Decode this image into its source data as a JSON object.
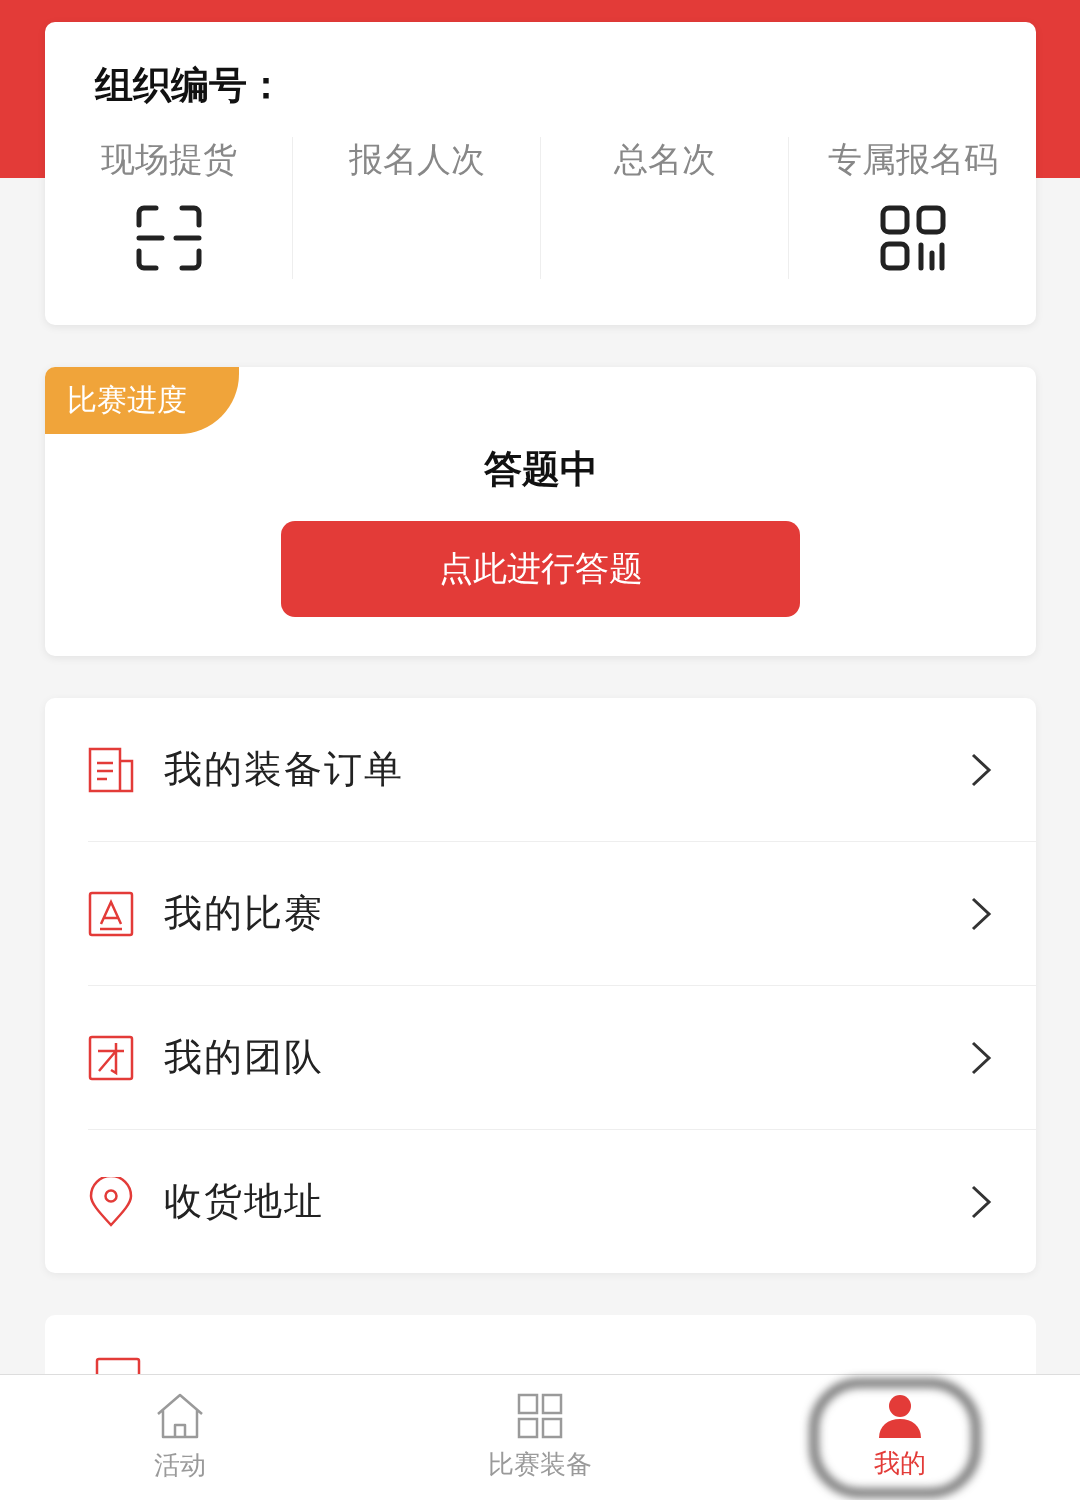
{
  "org": {
    "label": "组织编号："
  },
  "stats": [
    {
      "label": "现场提货",
      "kind": "scan"
    },
    {
      "label": "报名人次",
      "kind": "blank"
    },
    {
      "label": "总名次",
      "kind": "blank"
    },
    {
      "label": "专属报名码",
      "kind": "qr"
    }
  ],
  "progress": {
    "badge": "比赛进度",
    "status": "答题中",
    "button": "点此进行答题"
  },
  "menu": [
    {
      "label": "我的装备订单",
      "kind": "order"
    },
    {
      "label": "我的比赛",
      "kind": "contest"
    },
    {
      "label": "我的团队",
      "kind": "team"
    },
    {
      "label": "收货地址",
      "kind": "address"
    }
  ],
  "tabs": [
    {
      "label": "活动",
      "kind": "home",
      "selected": false
    },
    {
      "label": "比赛装备",
      "kind": "grid",
      "selected": false
    },
    {
      "label": "我的",
      "kind": "person",
      "selected": true
    }
  ]
}
